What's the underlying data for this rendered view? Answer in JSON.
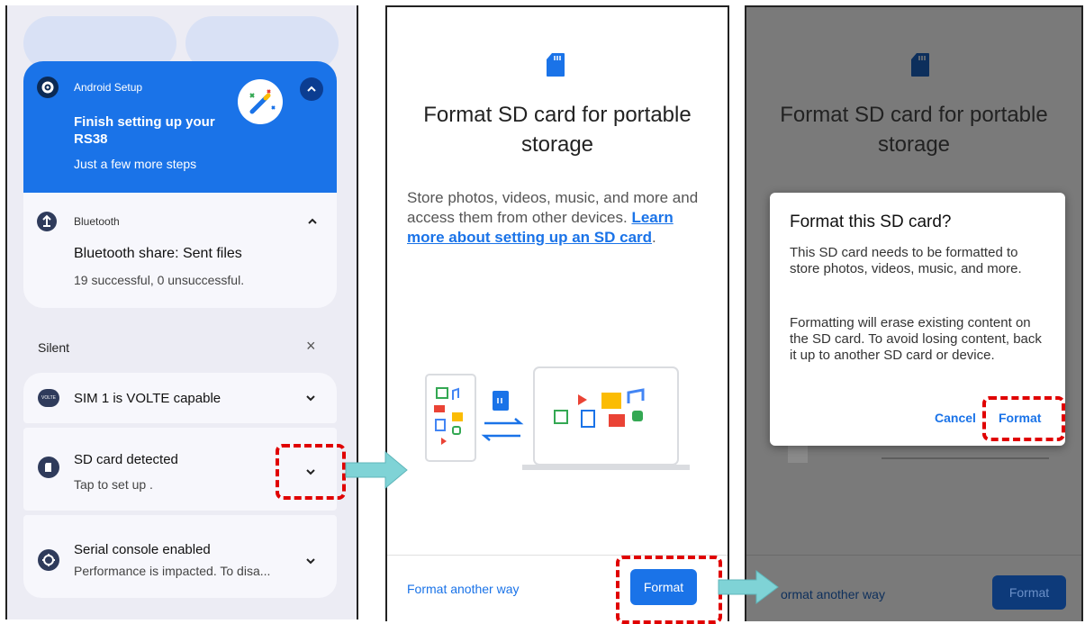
{
  "panel1": {
    "setup": {
      "app": "Android Setup",
      "title": "Finish setting up your RS38",
      "subtitle": "Just a few more steps"
    },
    "bluetooth": {
      "app": "Bluetooth",
      "title": "Bluetooth share: Sent files",
      "subtitle": "19 successful, 0 unsuccessful."
    },
    "silent_label": "Silent",
    "silent_close": "×",
    "sim": {
      "title": "SIM 1 is VOLTE capable",
      "badge": "VOLTE"
    },
    "sd": {
      "title": "SD card detected",
      "subtitle": "Tap to set up ."
    },
    "serial": {
      "title": "Serial console enabled",
      "subtitle": "Performance is impacted. To disa..."
    }
  },
  "panel2": {
    "heading": "Format SD card for portable storage",
    "body": "Store photos, videos, music, and more and access them from other devices.",
    "link": "Learn more about setting up an SD card",
    "link_suffix": ".",
    "format_another_way": "Format another way",
    "format_button": "Format"
  },
  "panel3": {
    "heading": "Format SD card for portable storage",
    "dialog": {
      "title": "Format this SD card?",
      "para1": "This SD card needs to be formatted to store photos, videos, music, and more.",
      "para2": "Formatting will erase existing content on the SD card. To avoid losing content, back it up to another SD card or device.",
      "cancel": "Cancel",
      "format": "Format"
    },
    "format_another_way": "ormat another way",
    "format_button": "Format"
  },
  "colors": {
    "accent": "#1a73e8",
    "highlight": "#e00000",
    "arrow": "#7fd3d6",
    "dim_overlay": "#7a7a7a"
  }
}
